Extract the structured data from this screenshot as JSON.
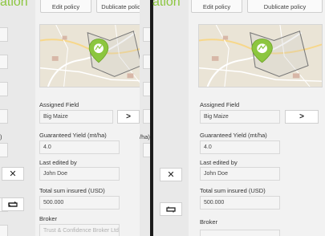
{
  "header": {
    "title_fragment": "ation",
    "edit_policy_label": "Edit policy",
    "duplicate_policy_label": "Dublicate policy"
  },
  "left_strip": {
    "ha_fragment": ")"
  },
  "right_strip": {
    "ha_fragment": "/ha)"
  },
  "form": {
    "assigned_field_label": "Assigned Field",
    "assigned_field_value": "Big Maize",
    "guaranteed_yield_label": "Guaranteed Yield (mt/ha)",
    "guaranteed_yield_value": "4.0",
    "last_edited_label": "Last edited by",
    "last_edited_value": "John Doe",
    "total_sum_label": "Total sum insured (USD)",
    "total_sum_value": "500.000",
    "broker_label": "Broker",
    "broker_value": "Trust & Confidence Broker Ltd"
  },
  "icons": {
    "chevron": "chevron-right-icon",
    "close": "close-icon",
    "transfer": "transfer-icon",
    "map_pin": "map-pin-icon"
  },
  "colors": {
    "accent_green": "#8cc63f",
    "background": "#f2f2f2",
    "field_bg": "#f4f4f4"
  }
}
